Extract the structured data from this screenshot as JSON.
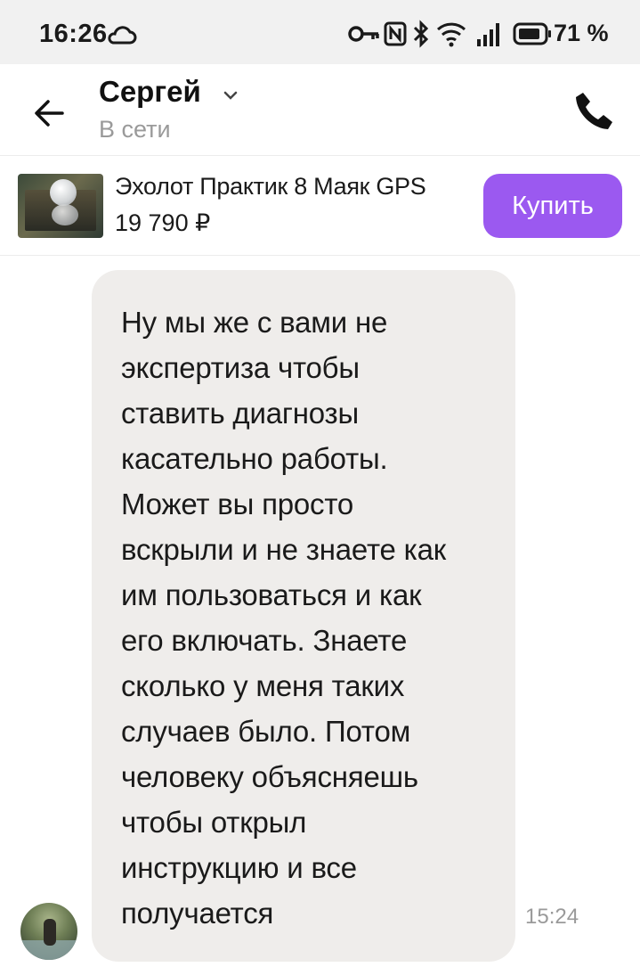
{
  "status_bar": {
    "time": "16:26",
    "battery_percent": "71 %",
    "icons": [
      "cloud-icon",
      "key-icon",
      "nfc-icon",
      "bluetooth-icon",
      "wifi-icon",
      "signal-icon",
      "battery-icon"
    ]
  },
  "header": {
    "contact_name": "Сергей",
    "contact_status": "В сети"
  },
  "product": {
    "title": "Эхолот Практик 8 Маяк GPS",
    "price": "19 790 ₽",
    "buy_label": "Купить",
    "accent_color": "#9b59f0"
  },
  "messages": [
    {
      "text": "Ну мы же с вами не\nэкспертиза чтобы\nставить диагнозы\nкасательно работы.\nМожет вы просто\nвскрыли и не знаете как\nим пользоваться и как\nего включать. Знаете\nсколько у меня таких\nслучаев было. Потом\nчеловеку объясняешь\nчтобы открыл\nинструкцию и все\nполучается",
      "time": "15:24"
    }
  ]
}
